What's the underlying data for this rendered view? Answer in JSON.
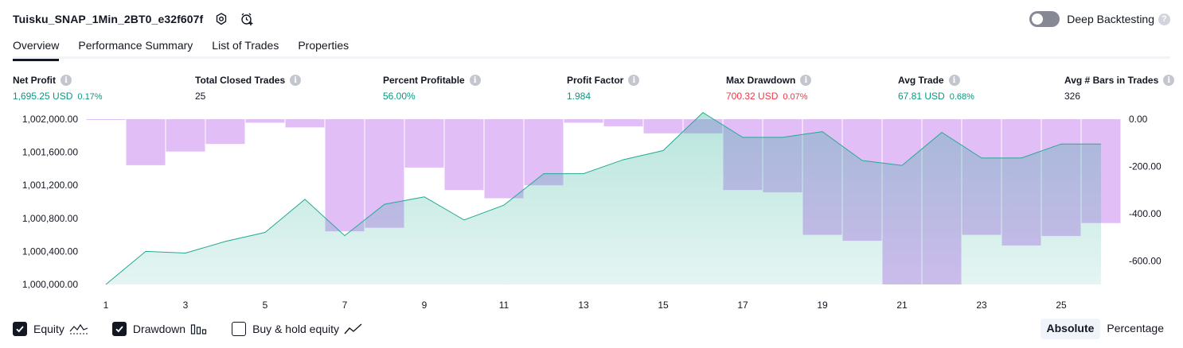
{
  "header": {
    "strategy_name": "Tuisku_SNAP_1Min_2BT0_e32f607f",
    "deep_backtesting_label": "Deep Backtesting",
    "deep_backtesting_enabled": false
  },
  "tabs": [
    {
      "label": "Overview",
      "active": true
    },
    {
      "label": "Performance Summary",
      "active": false
    },
    {
      "label": "List of Trades",
      "active": false
    },
    {
      "label": "Properties",
      "active": false
    }
  ],
  "stats": {
    "net_profit": {
      "title": "Net Profit",
      "value": "1,695.25 USD",
      "pct": "0.17%"
    },
    "total_closed_trades": {
      "title": "Total Closed Trades",
      "value": "25"
    },
    "percent_profitable": {
      "title": "Percent Profitable",
      "value": "56.00%"
    },
    "profit_factor": {
      "title": "Profit Factor",
      "value": "1.984"
    },
    "max_drawdown": {
      "title": "Max Drawdown",
      "value": "700.32 USD",
      "pct": "0.07%"
    },
    "avg_trade": {
      "title": "Avg Trade",
      "value": "67.81 USD",
      "pct": "0.68%"
    },
    "avg_bars": {
      "title": "Avg # Bars in Trades",
      "value": "326"
    }
  },
  "chart_data": {
    "type": "area",
    "left_axis_ticks": [
      "1,002,000.00",
      "1,001,600.00",
      "1,001,200.00",
      "1,000,800.00",
      "1,000,400.00",
      "1,000,000.00"
    ],
    "right_axis_ticks": [
      "0.00",
      "-200.00",
      "-400.00",
      "-600.00"
    ],
    "x_ticks": [
      "1",
      "3",
      "5",
      "7",
      "9",
      "11",
      "13",
      "15",
      "17",
      "19",
      "21",
      "23",
      "25"
    ],
    "left_ylim": [
      1000000,
      1002000
    ],
    "right_ylim": [
      -700,
      0
    ],
    "series": [
      {
        "name": "Equity",
        "color": "#22ab94",
        "x": [
          1,
          2,
          3,
          4,
          5,
          6,
          7,
          8,
          9,
          10,
          11,
          12,
          13,
          14,
          15,
          16,
          17,
          18,
          19,
          20,
          21,
          22,
          23,
          24,
          25,
          26
        ],
        "values": [
          1000000,
          1000400,
          1000380,
          1000520,
          1000630,
          1001030,
          1000590,
          1000970,
          1001060,
          1000780,
          1000960,
          1001340,
          1001340,
          1001510,
          1001620,
          1002080,
          1001780,
          1001780,
          1001850,
          1001500,
          1001440,
          1001840,
          1001530,
          1001530,
          1001700,
          1001700
        ]
      },
      {
        "name": "Drawdown",
        "color": "#ce93f2",
        "x": [
          1,
          2,
          3,
          4,
          5,
          6,
          7,
          8,
          9,
          10,
          11,
          12,
          13,
          14,
          15,
          16,
          17,
          18,
          19,
          20,
          21,
          22,
          23,
          24,
          25,
          26
        ],
        "values": [
          -3,
          -195,
          -137,
          -105,
          -15,
          -35,
          -475,
          -460,
          -205,
          -300,
          -335,
          -280,
          -15,
          -30,
          -60,
          -60,
          -300,
          -310,
          -490,
          -515,
          -700,
          -700,
          -490,
          -535,
          -495,
          -440
        ]
      }
    ],
    "grid": false
  },
  "legend": {
    "items": [
      {
        "label": "Equity",
        "checked": true
      },
      {
        "label": "Drawdown",
        "checked": true
      },
      {
        "label": "Buy & hold equity",
        "checked": false
      }
    ]
  },
  "modes": [
    {
      "label": "Absolute",
      "active": true
    },
    {
      "label": "Percentage",
      "active": false
    }
  ]
}
